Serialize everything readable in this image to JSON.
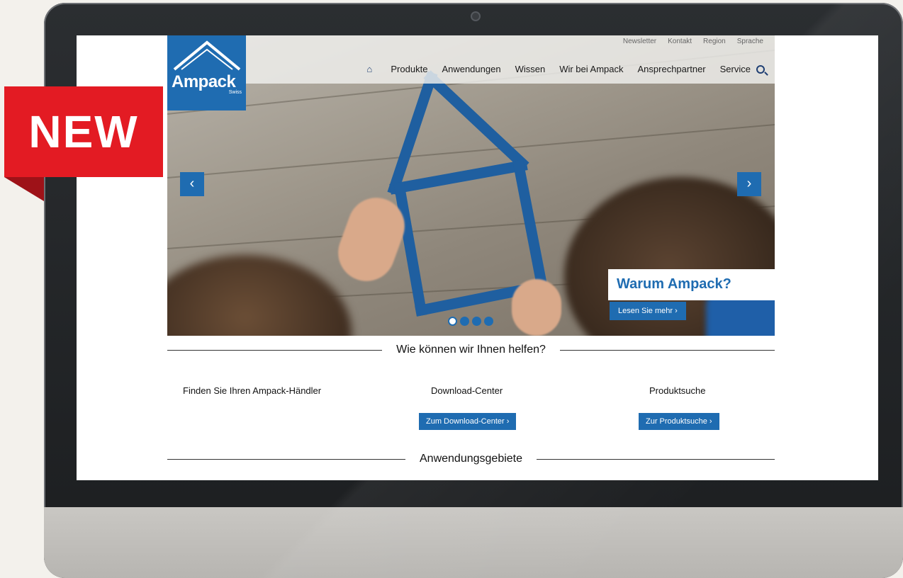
{
  "badge": {
    "text": "NEW"
  },
  "logo": {
    "name": "Ampack",
    "sub": "Swiss"
  },
  "util_links": [
    "Newsletter",
    "Kontakt",
    "Region",
    "Sprache"
  ],
  "main_nav": [
    "Produkte",
    "Anwendungen",
    "Wissen",
    "Wir bei Ampack",
    "Ansprechpartner",
    "Service"
  ],
  "icons": {
    "home": "home-icon",
    "search": "search-icon",
    "prev": "chevron-left-icon",
    "next": "chevron-right-icon"
  },
  "hero": {
    "prev_arrow": "‹",
    "next_arrow": "›",
    "callout_title": "Warum Ampack?",
    "callout_button": "Lesen Sie mehr ›",
    "slides_total": 4,
    "active_slide": 1
  },
  "help": {
    "heading": "Wie können wir Ihnen helfen?",
    "col1_title": "Finden Sie Ihren Ampack-Händler",
    "col2_title": "Download-Center",
    "col2_button": "Zum Download-Center ›",
    "col3_title": "Produktsuche",
    "col3_button": "Zur Produktsuche ›"
  },
  "applications": {
    "heading": "Anwendungsgebiete"
  },
  "colors": {
    "brand_blue": "#1f6cb1",
    "badge_red": "#e31b23"
  }
}
